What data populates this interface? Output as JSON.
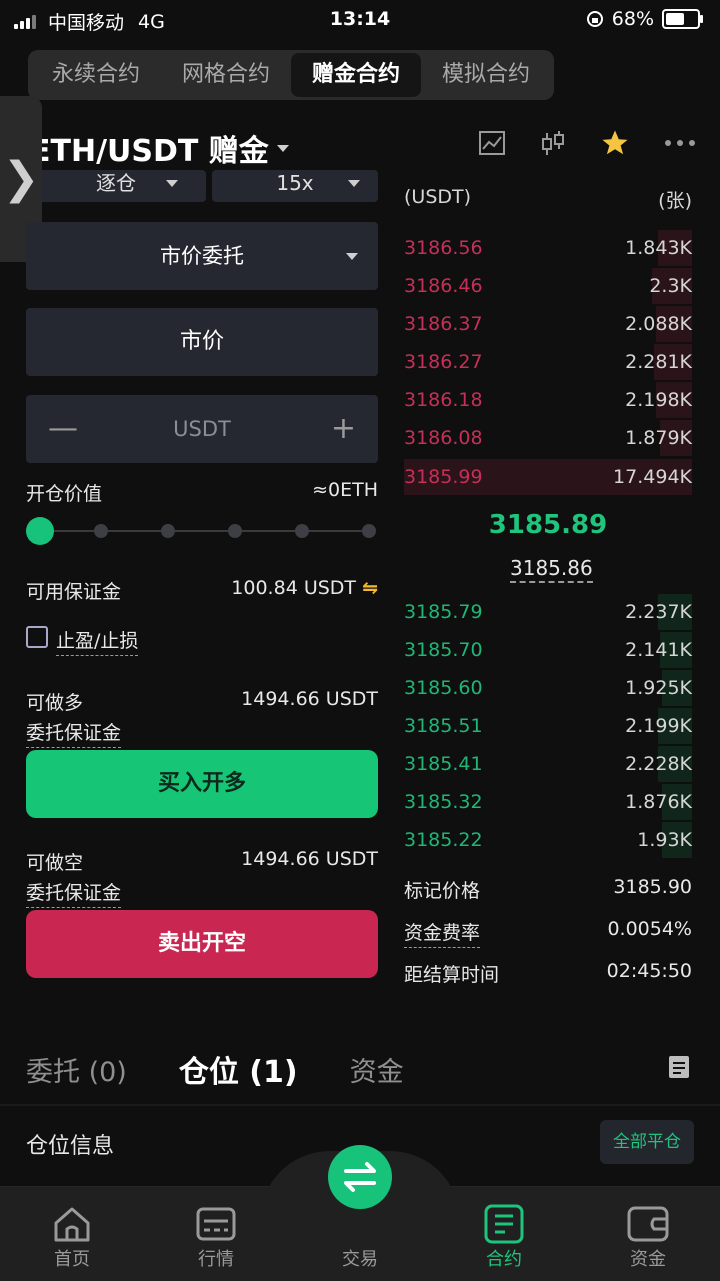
{
  "status": {
    "carrier": "中国移动",
    "network": "4G",
    "time": "13:14",
    "battery": "68%",
    "battery_level": 0.68
  },
  "tabs": [
    "永续合约",
    "网格合约",
    "赠金合约",
    "模拟合约"
  ],
  "active_tab": 2,
  "pair": {
    "symbol": "ETH/USDT 赠金"
  },
  "form": {
    "margin_mode": "逐仓",
    "leverage": "15x",
    "order_type": "市价委托",
    "price": "市价",
    "qty_placeholder": "USDT",
    "open_value_label": "开仓价值",
    "open_value": "≈0ETH",
    "available_label": "可用保证金",
    "available": "100.84 USDT",
    "tpsl_label": "止盈/止损",
    "long_label": "可做多",
    "long_value": "1494.66 USDT",
    "long_margin_label": "委托保证金",
    "buy_label": "买入开多",
    "short_label": "可做空",
    "short_value": "1494.66 USDT",
    "short_margin_label": "委托保证金",
    "sell_label": "卖出开空",
    "leverage_slider_level": 0
  },
  "orderbook": {
    "price_header": "(USDT)",
    "qty_header": "(张)",
    "asks": [
      {
        "price": "3186.56",
        "qty": "1.843K"
      },
      {
        "price": "3186.46",
        "qty": "2.3K"
      },
      {
        "price": "3186.37",
        "qty": "2.088K"
      },
      {
        "price": "3186.27",
        "qty": "2.281K"
      },
      {
        "price": "3186.18",
        "qty": "2.198K"
      },
      {
        "price": "3186.08",
        "qty": "1.879K"
      },
      {
        "price": "3185.99",
        "qty": "17.494K"
      }
    ],
    "last_price": "3185.89",
    "mark_price": "3185.86",
    "bids": [
      {
        "price": "3185.79",
        "qty": "2.237K"
      },
      {
        "price": "3185.70",
        "qty": "2.141K"
      },
      {
        "price": "3185.60",
        "qty": "1.925K"
      },
      {
        "price": "3185.51",
        "qty": "2.199K"
      },
      {
        "price": "3185.41",
        "qty": "2.228K"
      },
      {
        "price": "3185.32",
        "qty": "1.876K"
      },
      {
        "price": "3185.22",
        "qty": "1.93K"
      }
    ]
  },
  "market_info": {
    "mark_label": "标记价格",
    "mark_value": "3185.90",
    "funding_label": "资金费率",
    "funding_value": "0.0054%",
    "settle_label": "距结算时间",
    "settle_value": "02:45:50"
  },
  "bottom_tabs": [
    "委托 (0)",
    "仓位 (1)",
    "资金"
  ],
  "position": {
    "info_label": "仓位信息",
    "close_all": "全部平仓"
  },
  "nav": [
    "首页",
    "行情",
    "交易",
    "合约",
    "资金"
  ],
  "colors": {
    "green": "#17c27a",
    "red": "#c92651",
    "bg": "#0f0f0f"
  }
}
